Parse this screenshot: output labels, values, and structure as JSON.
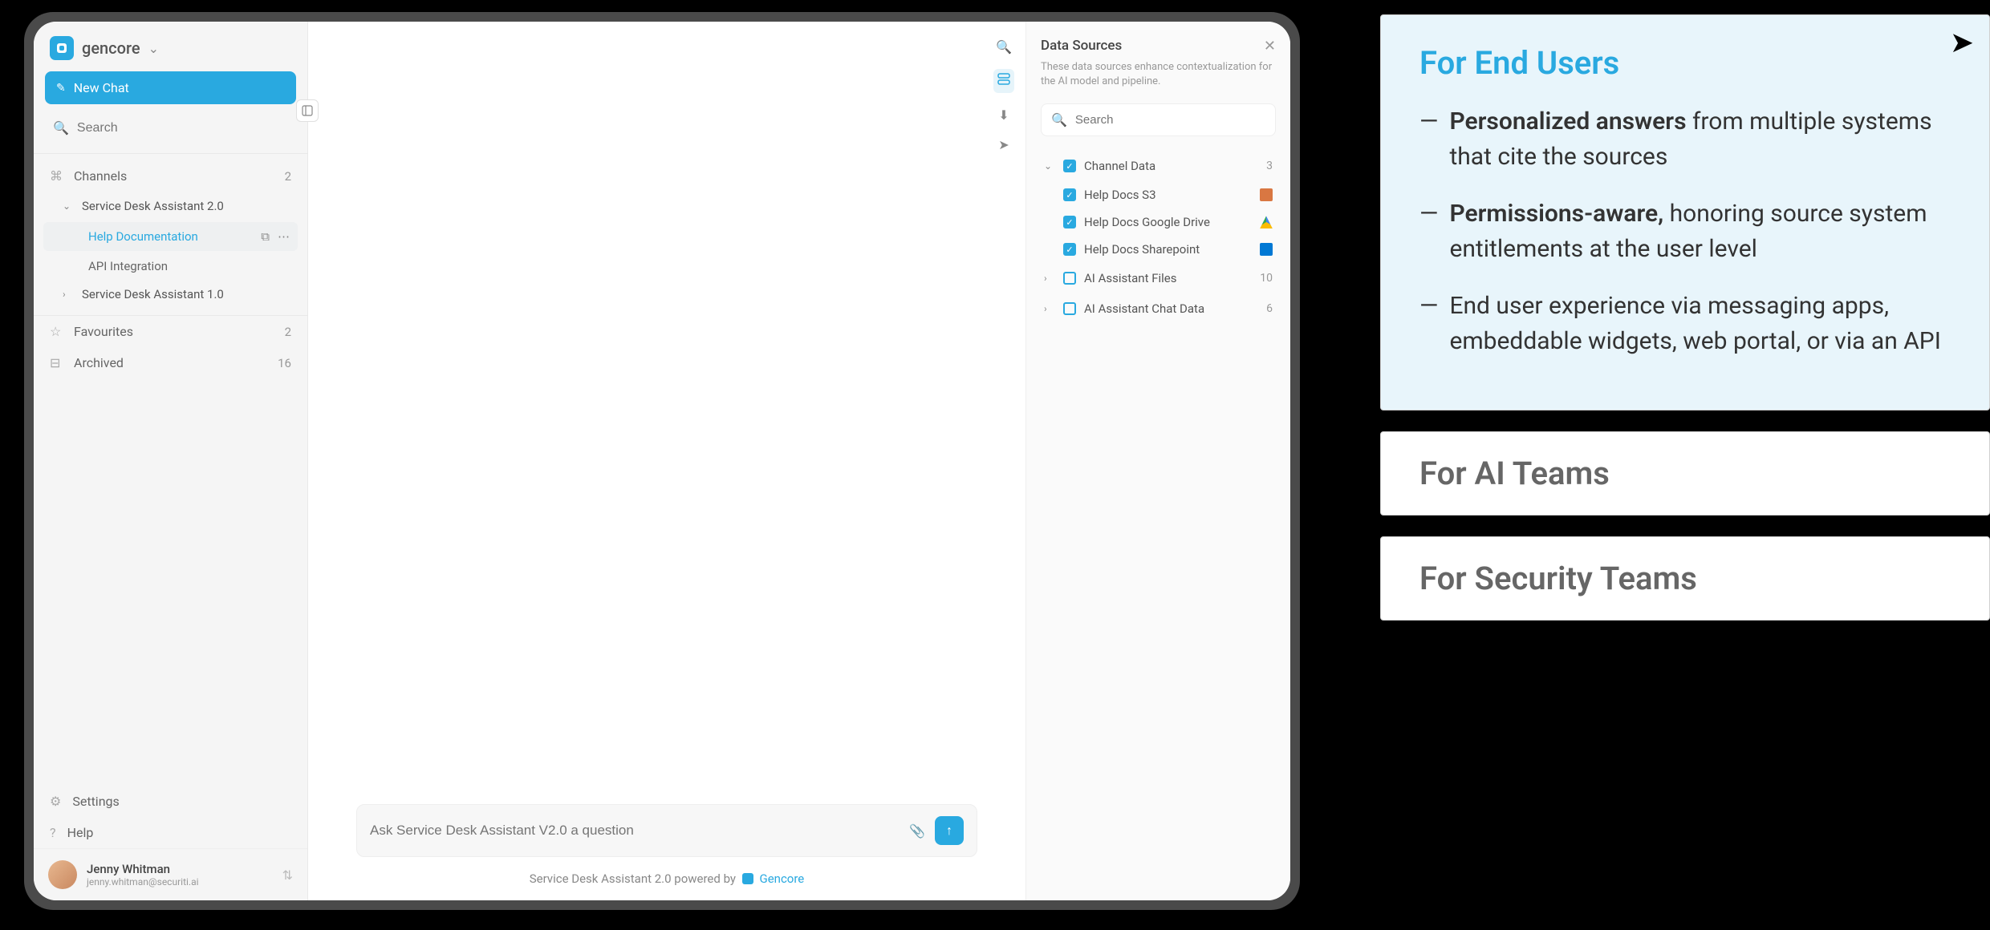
{
  "brand": "gencore",
  "newChat": "New Chat",
  "sidebarSearch": "Search",
  "channels": {
    "label": "Channels",
    "count": "2"
  },
  "tree": {
    "svc20": "Service Desk Assistant 2.0",
    "helpDoc": "Help Documentation",
    "apiInt": "API Integration",
    "svc10": "Service Desk Assistant 1.0"
  },
  "favourites": {
    "label": "Favourites",
    "count": "2"
  },
  "archived": {
    "label": "Archived",
    "count": "16"
  },
  "settings": "Settings",
  "help": "Help",
  "user": {
    "name": "Jenny Whitman",
    "email": "jenny.whitman@securiti.ai"
  },
  "input": {
    "placeholder": "Ask Service Desk Assistant V2.0 a question"
  },
  "powered": {
    "prefix": "Service Desk Assistant 2.0 powered by",
    "brand": "Gencore"
  },
  "ds": {
    "title": "Data Sources",
    "desc": "These data sources enhance contextualization for the AI model and pipeline.",
    "search": "Search",
    "groups": [
      {
        "name": "Channel Data",
        "count": "3",
        "expanded": true,
        "checked": true,
        "items": [
          {
            "name": "Help Docs S3",
            "icon": "s3"
          },
          {
            "name": "Help Docs Google Drive",
            "icon": "gd"
          },
          {
            "name": "Help Docs Sharepoint",
            "icon": "sp"
          }
        ]
      },
      {
        "name": "AI Assistant Files",
        "count": "10",
        "expanded": false,
        "checked": false
      },
      {
        "name": "AI Assistant Chat Data",
        "count": "6",
        "expanded": false,
        "checked": false
      }
    ]
  },
  "cards": {
    "endUsers": {
      "title": "For End Users",
      "bullets": [
        {
          "bold": "Personalized answers",
          "rest": " from multiple systems that cite the sources"
        },
        {
          "bold": "Permissions-aware,",
          "rest": " honoring source system entitlements at the user level"
        },
        {
          "bold": "",
          "rest": "End user experience via messaging apps, embeddable widgets, web portal, or via an API"
        }
      ]
    },
    "aiTeams": "For AI Teams",
    "secTeams": "For Security Teams"
  }
}
